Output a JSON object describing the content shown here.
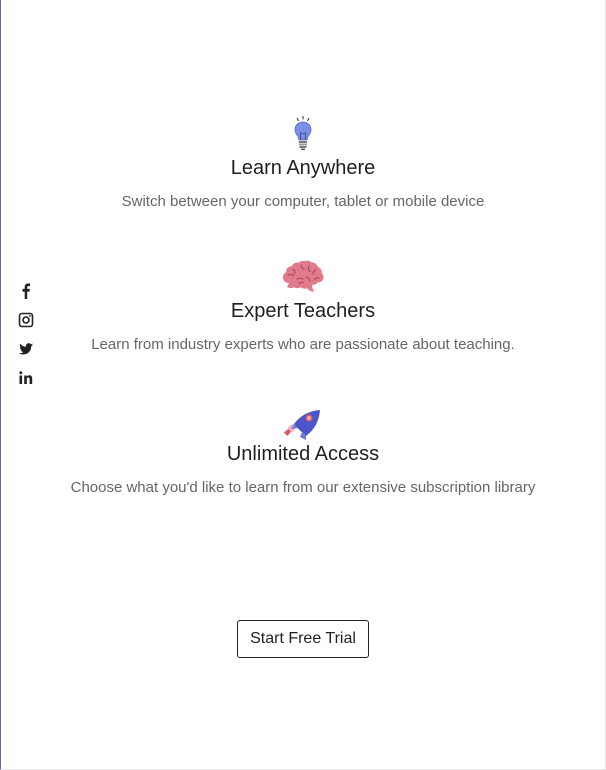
{
  "social": [
    {
      "name": "facebook",
      "icon": "facebook-icon"
    },
    {
      "name": "instagram",
      "icon": "instagram-icon"
    },
    {
      "name": "twitter",
      "icon": "twitter-icon"
    },
    {
      "name": "linkedin",
      "icon": "linkedin-icon"
    }
  ],
  "features": [
    {
      "icon": "lightbulb-icon",
      "title": "Learn Anywhere",
      "description": "Switch between your computer, tablet or mobile device"
    },
    {
      "icon": "brain-icon",
      "title": "Expert Teachers",
      "description": "Learn from industry experts who are passionate about teaching."
    },
    {
      "icon": "rocket-icon",
      "title": "Unlimited Access",
      "description": "Choose what you'd like to learn from our extensive subscription library"
    }
  ],
  "cta": {
    "label": "Start Free Trial"
  },
  "colors": {
    "bulb": "#7a8fe8",
    "brain": "#e07a8c",
    "rocket": "#4b54c9",
    "rocket_accent": "#e05565",
    "title": "#1f1f1f",
    "description": "#666666"
  }
}
